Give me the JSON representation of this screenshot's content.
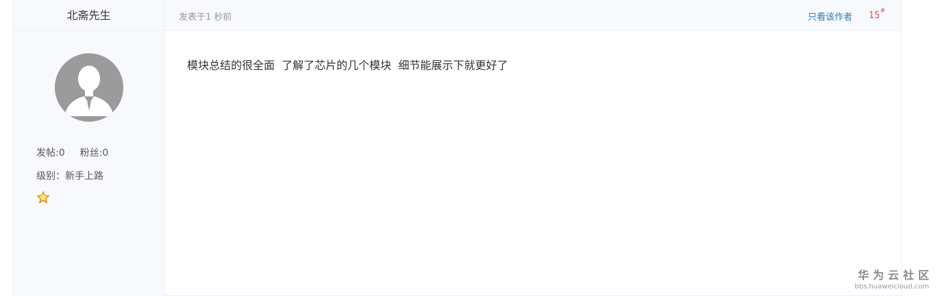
{
  "author": {
    "name": "北斋先生",
    "stats": {
      "posts_label": "发帖:0",
      "fans_label": "粉丝:0"
    },
    "level_label": "级别：新手上路",
    "avatar_icon": "default-user-avatar-icon",
    "badge_icon": "star-badge-icon"
  },
  "post": {
    "time": "发表于1 秒前",
    "only_author_link": "只看该作者",
    "floor_number": "15",
    "floor_mark": "#",
    "body": "模块总结的很全面  了解了芯片的几个模块  细节能展示下就更好了"
  },
  "watermark": {
    "title": "华为云社区",
    "url": "bbs.huaweicloud.com"
  },
  "colors": {
    "sidebar_bg": "#f7f9fd",
    "link": "#2d7bb5",
    "floor": "#e04848",
    "avatar": "#9b9b9b"
  }
}
